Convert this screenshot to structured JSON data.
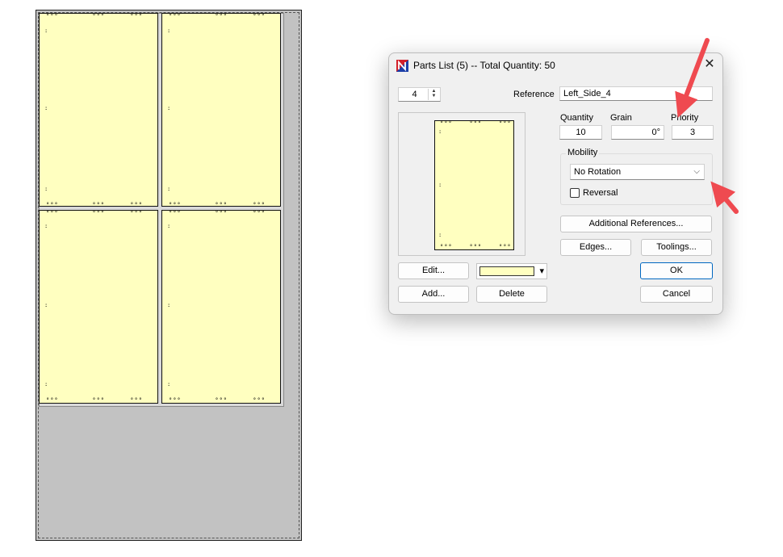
{
  "dialog": {
    "title": "Parts List (5) -- Total Quantity: 50",
    "close_glyph": "✕",
    "index_value": "4",
    "reference_label": "Reference",
    "reference_value": "Left_Side_4",
    "quantity_label": "Quantity",
    "quantity_value": "10",
    "grain_label": "Grain",
    "grain_value": "0°",
    "priority_label": "Priority",
    "priority_value": "3",
    "mobility_label": "Mobility",
    "mobility_value": "No Rotation",
    "reversal_label": "Reversal",
    "reversal_checked": false,
    "color_swatch": "#ffffc0",
    "buttons": {
      "edit": "Edit...",
      "add": "Add...",
      "delete": "Delete",
      "additional_refs": "Additional References...",
      "edges": "Edges...",
      "toolings": "Toolings...",
      "ok": "OK",
      "cancel": "Cancel"
    }
  },
  "colors": {
    "panel_fill": "#ffffc0",
    "sheet_fill": "#c2c2c2",
    "arrow": "#ef4a50",
    "accent": "#0067c0"
  },
  "icons": {
    "app": "nesting-app-icon",
    "spin_up": "▲",
    "spin_down": "▼",
    "dropdown": "⌵",
    "color_drop": "▾"
  }
}
